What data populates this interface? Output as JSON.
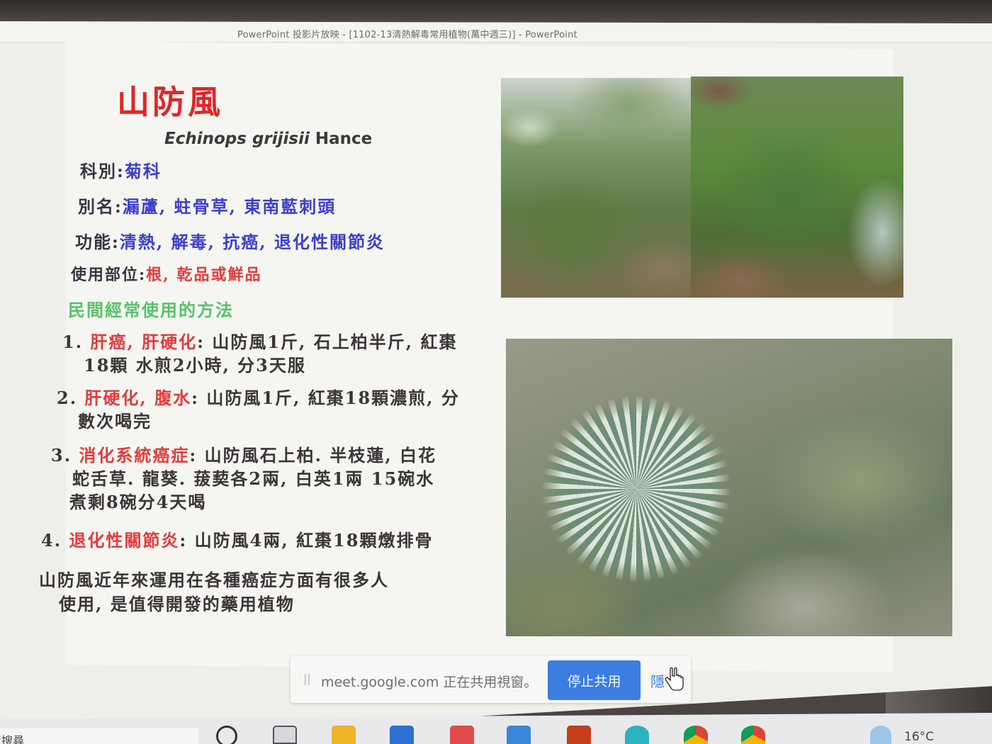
{
  "window": {
    "title": "PowerPoint 投影片放映 - [1102-13清熱解毒常用植物(萬中週三)] - PowerPoint"
  },
  "slide": {
    "title": "山防風",
    "latin_name": "Echinops grijisii",
    "latin_author": "Hance",
    "family_label": "科別:",
    "family_value": "菊科",
    "alias_label": "別名:",
    "alias_value": "漏蘆, 蛀骨草, 東南藍刺頭",
    "function_label": "功能:",
    "function_value": "清熱, 解毒, 抗癌, 退化性關節炎",
    "part_label": "使用部位:",
    "part_value": "根, 乾品或鮮品",
    "methods_heading": "民間經常使用的方法",
    "methods": [
      {
        "num": "1.",
        "condition": "肝癌, 肝硬化",
        "line1": ": 山防風1斤, 石上柏半斤, 紅棗",
        "line2": "18顆 水煎2小時, 分3天服"
      },
      {
        "num": "2.",
        "condition": "肝硬化, 腹水",
        "line1": ": 山防風1斤, 紅棗18顆濃煎, 分",
        "line2": "數次喝完"
      },
      {
        "num": "3.",
        "condition": "消化系統癌症",
        "line1": ": 山防風石上柏. 半枝蓮, 白花",
        "line2": "蛇舌草. 龍葵. 菝葜各2兩, 白英1兩 15碗水",
        "line3": "煮剩8碗分4天喝"
      },
      {
        "num": "4.",
        "condition": "退化性關節炎",
        "line1": ": 山防風4兩, 紅棗18顆燉排骨"
      }
    ],
    "summary_line1": "山防風近年來運用在各種癌症方面有很多人",
    "summary_line2": "使用, 是值得開發的藥用植物"
  },
  "share_bar": {
    "grip": "||",
    "message": "meet.google.com 正在共用視窗。",
    "stop_label": "停止共用",
    "hide_label": "隱"
  },
  "taskbar": {
    "search_label": "搜尋",
    "weather": "16°C"
  },
  "colors": {
    "title_red": "#e0262a",
    "value_blue": "#3b3fc9",
    "highlight_red": "#e23b3b",
    "heading_green": "#57c267",
    "button_blue": "#3b7de0"
  }
}
